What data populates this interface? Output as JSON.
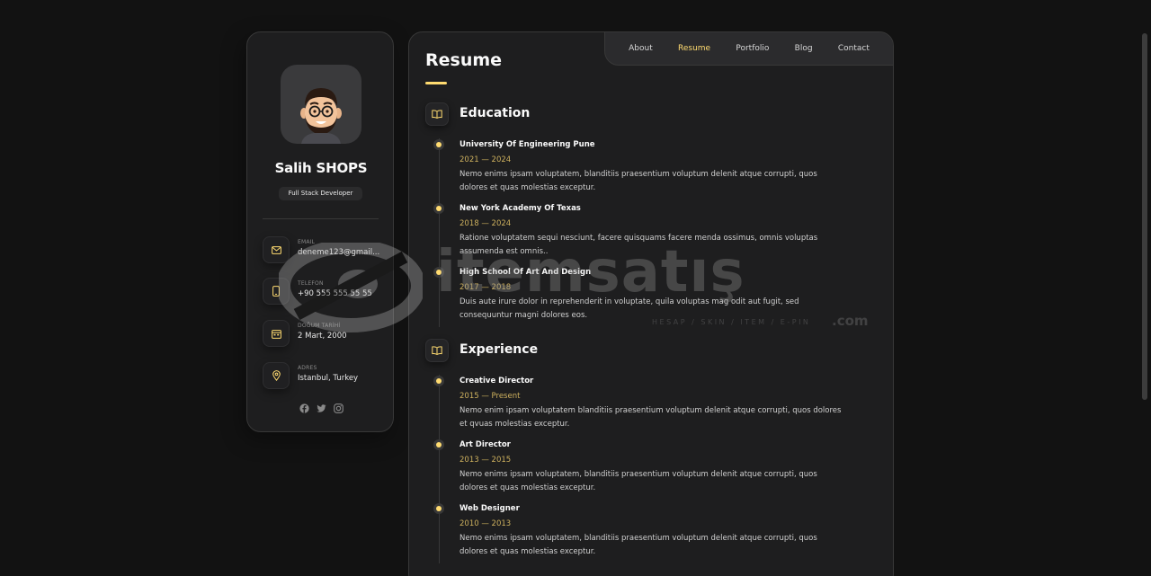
{
  "profile": {
    "name": "Salih SHOPS",
    "title": "Full Stack Developer"
  },
  "contacts": [
    {
      "label": "EMAIL",
      "value": "deneme123@gmail...",
      "icon": "mail-icon"
    },
    {
      "label": "TELEFON",
      "value": "+90 555 555 55 55",
      "icon": "phone-icon"
    },
    {
      "label": "DOĞUM TARİHİ",
      "value": "2 Mart, 2000",
      "icon": "calendar-icon"
    },
    {
      "label": "ADRES",
      "value": "Istanbul, Turkey",
      "icon": "location-icon"
    }
  ],
  "socials": [
    "facebook-icon",
    "twitter-icon",
    "instagram-icon"
  ],
  "nav": {
    "items": [
      "About",
      "Resume",
      "Portfolio",
      "Blog",
      "Contact"
    ],
    "active": "Resume"
  },
  "page_title": "Resume",
  "education": {
    "title": "Education",
    "items": [
      {
        "title": "University Of Engineering Pune",
        "date": "2021 — 2024",
        "text": "Nemo enims ipsam voluptatem, blanditiis praesentium voluptum delenit atque corrupti, quos dolores et quas molestias exceptur."
      },
      {
        "title": "New York Academy Of Texas",
        "date": "2018 — 2024",
        "text": "Ratione voluptatem sequi nesciunt, facere quisquams facere menda ossimus, omnis voluptas assumenda est omnis.."
      },
      {
        "title": "High School Of Art And Design",
        "date": "2017 — 2018",
        "text": "Duis aute irure dolor in reprehenderit in voluptate, quila voluptas mag odit aut fugit, sed consequuntur magni dolores eos."
      }
    ]
  },
  "experience": {
    "title": "Experience",
    "items": [
      {
        "title": "Creative Director",
        "date": "2015 — Present",
        "text": "Nemo enim ipsam voluptatem blanditiis praesentium voluptum delenit atque corrupti, quos dolores et qvuas molestias exceptur."
      },
      {
        "title": "Art Director",
        "date": "2013 — 2015",
        "text": "Nemo enims ipsam voluptatem, blanditiis praesentium voluptum delenit atque corrupti, quos dolores et quas molestias exceptur."
      },
      {
        "title": "Web Designer",
        "date": "2010 — 2013",
        "text": "Nemo enims ipsam voluptatem, blanditiis praesentium voluptum delenit atque corrupti, quos dolores et quas molestias exceptur."
      }
    ]
  },
  "watermark": {
    "brand": "itemsatış",
    "tagline": "HESAP / SKIN / ITEM / E-PIN",
    "suffix": ".com"
  },
  "colors": {
    "accent": "#ffdb70",
    "date": "#ceb15e",
    "background": "#121212",
    "card": "#1e1e1f"
  }
}
